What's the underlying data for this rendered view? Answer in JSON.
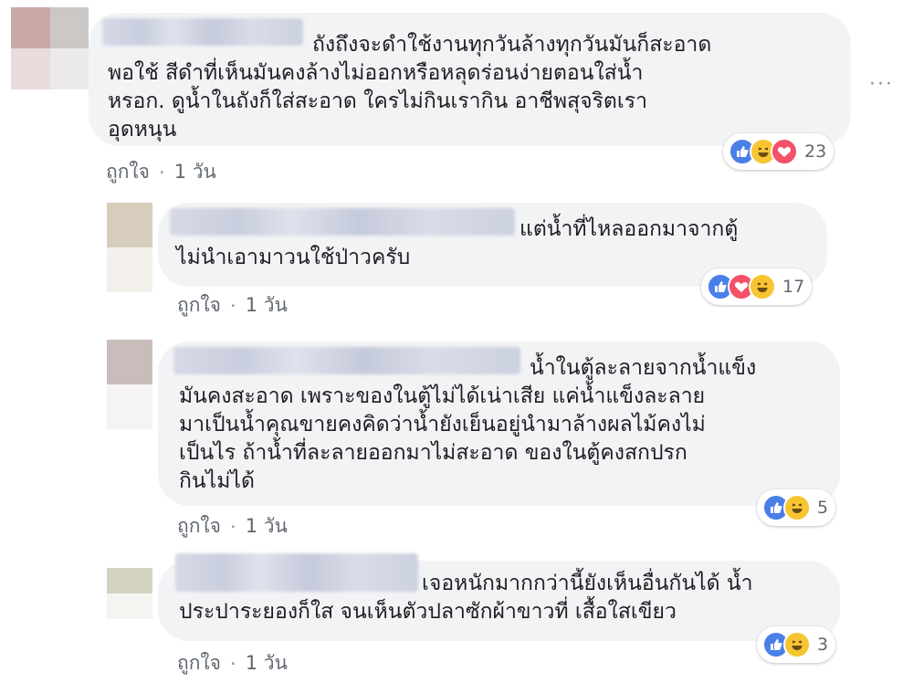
{
  "comments": [
    {
      "text": "ถังถึงจะดำใช้งานทุกวันล้างทุกวันมันก็สะอาด\nพอใช้ สีดำที่เห็นมันคงล้างไม่ออกหรือหลุดร่อนง่ายตอนใส่น้ำ\nหรอก. ดูน้ำในถังก็ใส่สะอาด ใครไม่กินเรากิน อาชีพสุจริตเรา\nอุดหนุน",
      "like_label": "ถูกใจ",
      "separator": "·",
      "time": "1 วัน",
      "reaction_count": "23",
      "reactions": [
        "like-icon",
        "haha-icon",
        "love-icon"
      ]
    },
    {
      "text": "แต่น้ำที่ไหลออกมาจากตู้\nไม่นำเอามาวนใช้ป่าวครับ",
      "like_label": "ถูกใจ",
      "separator": "·",
      "time": "1 วัน",
      "reaction_count": "17",
      "reactions": [
        "like-icon",
        "love-icon",
        "haha-icon"
      ]
    },
    {
      "text": "น้ำในตู้ละลายจากน้ำแข็ง\nมันคงสะอาด เพราะของในตู้ไม่ได้เน่าเสีย แค่น้ำแข็งละลาย\nมาเป็นน้ำคุณขายคงคิดว่าน้ำยังเย็นอยู่นำมาล้างผลไม้คงไม่\nเป็นไร ถ้าน้ำที่ละลายออกมาไม่สะอาด ของในตู้คงสกปรก\nกินไม่ได้",
      "like_label": "ถูกใจ",
      "separator": "·",
      "time": "1 วัน",
      "reaction_count": "5",
      "reactions": [
        "like-icon",
        "haha-icon"
      ]
    },
    {
      "text": "เจอหนักมากกว่านี้ยังเห็นอื่นกันได้ น้ำ\nประปาระยองก็ใส จนเห็นตัวปลาซักผ้าขาวที่ เสื้อใสเขียว",
      "like_label": "ถูกใจ",
      "separator": "·",
      "time": "1 วัน",
      "reaction_count": "3",
      "reactions": [
        "like-icon",
        "haha-icon"
      ]
    }
  ],
  "more_label": "···",
  "colors": {
    "bubble": "#f2f3f5",
    "meta_text": "#606770",
    "like": "#4a7fe8",
    "haha": "#f7c531",
    "love": "#f25268"
  }
}
